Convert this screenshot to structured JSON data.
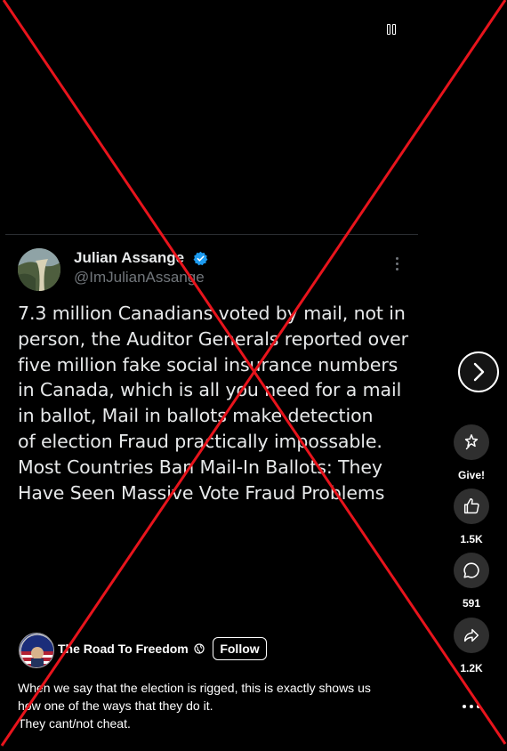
{
  "player": {
    "pause_icon": "pause-icon"
  },
  "tweet": {
    "author_name": "Julian Assange",
    "author_handle": "@ImJulianAssange",
    "verified_color": "#1d9bf0",
    "lines": [
      "7.3 million Canadians voted by mail, not in",
      "person, the Auditor Generals reported over",
      "five million fake social insurance numbers",
      "in Canada, which is all you need for a mail",
      "in ballot, Mail in ballots make detection",
      "of election Fraud practically impossable.",
      "Most Countries Ban Mail-In Ballots: They",
      "Have Seen Massive Vote Fraud Problems"
    ]
  },
  "rail": {
    "give_label": "Give!",
    "likes": "1.5K",
    "comments": "591",
    "shares": "1.2K"
  },
  "post": {
    "page_name": "The Road To Freedom",
    "follow_label": "Follow",
    "caption_lines": [
      "When we say that the election is rigged, this is exactly shows us",
      "how one of the ways that they do it.",
      "They cant/not cheat."
    ]
  },
  "overlay": {
    "color": "#e8141c"
  }
}
